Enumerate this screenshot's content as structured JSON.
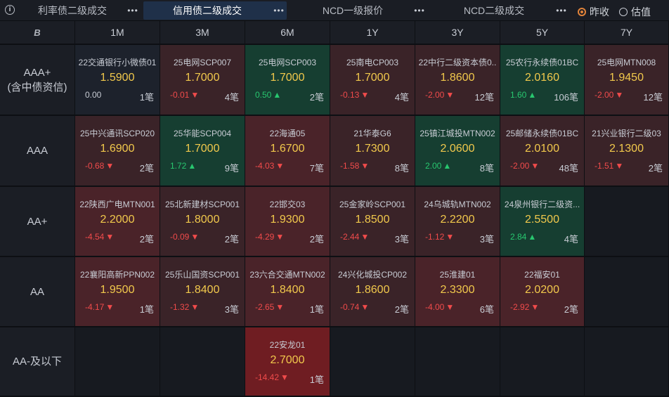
{
  "header": {
    "info_icon": "i",
    "tabs": [
      {
        "label": "利率债二级成交",
        "more": "•••",
        "active": false
      },
      {
        "label": "信用债二级成交",
        "more": "•••",
        "active": true
      },
      {
        "label": "NCD一级报价",
        "more": "•••",
        "active": false
      },
      {
        "label": "NCD二级成交",
        "more": "•••",
        "active": false
      }
    ],
    "radios": [
      {
        "label": "昨收",
        "selected": true
      },
      {
        "label": "估值",
        "selected": false
      }
    ]
  },
  "grid": {
    "logo": "B",
    "columns": [
      "1M",
      "3M",
      "6M",
      "1Y",
      "3Y",
      "5Y",
      "7Y"
    ],
    "rows": [
      {
        "label_lines": [
          "AAA+",
          "(含中债资信)"
        ],
        "cells": [
          {
            "name": "22交通银行小微债01",
            "yield": "1.5900",
            "change": "0.00",
            "dir": "flat",
            "arrow": "",
            "count": "1笔"
          },
          {
            "name": "25电网SCP007",
            "yield": "1.7000",
            "change": "-0.01",
            "dir": "down",
            "arrow": "▼",
            "count": "4笔"
          },
          {
            "name": "25电网SCP003",
            "yield": "1.7000",
            "change": "0.50",
            "dir": "up",
            "arrow": "▲",
            "count": "2笔"
          },
          {
            "name": "25南电CP003",
            "yield": "1.7000",
            "change": "-0.13",
            "dir": "down",
            "arrow": "▼",
            "count": "4笔"
          },
          {
            "name": "22中行二级资本债0..",
            "yield": "1.8600",
            "change": "-2.00",
            "dir": "down",
            "arrow": "▼",
            "count": "12笔"
          },
          {
            "name": "25农行永续债01BC",
            "yield": "2.0160",
            "change": "1.60",
            "dir": "up",
            "arrow": "▲",
            "count": "106笔"
          },
          {
            "name": "25电网MTN008",
            "yield": "1.9450",
            "change": "-2.00",
            "dir": "down",
            "arrow": "▼",
            "count": "12笔"
          }
        ]
      },
      {
        "label_lines": [
          "AAA"
        ],
        "cells": [
          {
            "name": "25中兴通讯SCP020",
            "yield": "1.6900",
            "change": "-0.68",
            "dir": "down",
            "arrow": "▼",
            "count": "2笔"
          },
          {
            "name": "25华能SCP004",
            "yield": "1.7000",
            "change": "1.72",
            "dir": "up",
            "arrow": "▲",
            "count": "9笔"
          },
          {
            "name": "22海通05",
            "yield": "1.6700",
            "change": "-4.03",
            "dir": "down",
            "arrow": "▼",
            "count": "7笔"
          },
          {
            "name": "21华泰G6",
            "yield": "1.7300",
            "change": "-1.58",
            "dir": "down",
            "arrow": "▼",
            "count": "8笔"
          },
          {
            "name": "25镇江城投MTN002",
            "yield": "2.0600",
            "change": "2.00",
            "dir": "up",
            "arrow": "▲",
            "count": "8笔"
          },
          {
            "name": "25邮储永续债01BC",
            "yield": "2.0100",
            "change": "-2.00",
            "dir": "down",
            "arrow": "▼",
            "count": "48笔"
          },
          {
            "name": "21兴业银行二级03",
            "yield": "2.1300",
            "change": "-1.51",
            "dir": "down",
            "arrow": "▼",
            "count": "2笔"
          }
        ]
      },
      {
        "label_lines": [
          "AA+"
        ],
        "cells": [
          {
            "name": "22陕西广电MTN001",
            "yield": "2.2000",
            "change": "-4.54",
            "dir": "down",
            "arrow": "▼",
            "count": "2笔"
          },
          {
            "name": "25北新建材SCP001",
            "yield": "1.8000",
            "change": "-0.09",
            "dir": "down",
            "arrow": "▼",
            "count": "2笔"
          },
          {
            "name": "22邯交03",
            "yield": "1.9300",
            "change": "-4.29",
            "dir": "down",
            "arrow": "▼",
            "count": "2笔"
          },
          {
            "name": "25金家岭SCP001",
            "yield": "1.8500",
            "change": "-2.44",
            "dir": "down",
            "arrow": "▼",
            "count": "3笔"
          },
          {
            "name": "24乌城轨MTN002",
            "yield": "2.2200",
            "change": "-1.12",
            "dir": "down",
            "arrow": "▼",
            "count": "3笔"
          },
          {
            "name": "24泉州银行二级资...",
            "yield": "2.5500",
            "change": "2.84",
            "dir": "up",
            "arrow": "▲",
            "count": "4笔"
          },
          null
        ]
      },
      {
        "label_lines": [
          "AA"
        ],
        "cells": [
          {
            "name": "22襄阳高新PPN002",
            "yield": "1.9500",
            "change": "-4.17",
            "dir": "down",
            "arrow": "▼",
            "count": "1笔"
          },
          {
            "name": "25乐山国资SCP001",
            "yield": "1.8400",
            "change": "-1.32",
            "dir": "down",
            "arrow": "▼",
            "count": "3笔"
          },
          {
            "name": "23六合交通MTN002",
            "yield": "1.8400",
            "change": "-2.65",
            "dir": "down",
            "arrow": "▼",
            "count": "1笔"
          },
          {
            "name": "24兴化城投CP002",
            "yield": "1.8600",
            "change": "-0.74",
            "dir": "down",
            "arrow": "▼",
            "count": "2笔"
          },
          {
            "name": "25淮建01",
            "yield": "2.3300",
            "change": "-4.00",
            "dir": "down",
            "arrow": "▼",
            "count": "6笔"
          },
          {
            "name": "22福安01",
            "yield": "2.0200",
            "change": "-2.92",
            "dir": "down",
            "arrow": "▼",
            "count": "2笔"
          },
          null
        ]
      },
      {
        "label_lines": [
          "AA-及以下"
        ],
        "cells": [
          null,
          null,
          {
            "name": "22安龙01",
            "yield": "2.7000",
            "change": "-14.42",
            "dir": "down",
            "arrow": "▼",
            "count": "1笔"
          },
          null,
          null,
          null,
          null
        ]
      }
    ]
  },
  "colors": {
    "down_text": "#f04b4b",
    "up_text": "#28c76f",
    "yield_text": "#f2c94c",
    "accent_radio": "#e0833a",
    "active_tab": "#1f3049"
  }
}
